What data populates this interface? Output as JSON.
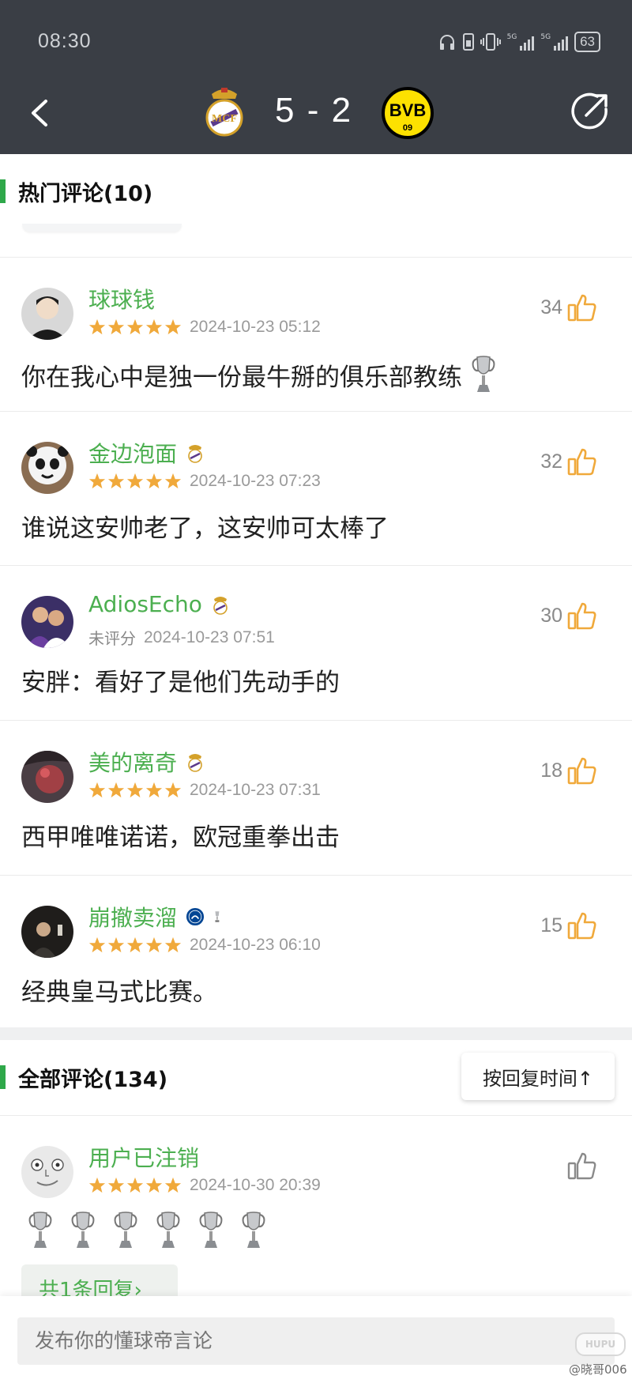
{
  "status_bar": {
    "time": "08:30",
    "battery": "63"
  },
  "match": {
    "score": "5 - 2"
  },
  "hot_section": {
    "title": "热门评论(10)"
  },
  "hot_comments": [
    {
      "user": "球球钱",
      "rated": true,
      "date": "2024-10-23 05:12",
      "text": "你在我心中是独一份最牛掰的俱乐部教练",
      "likes": "34"
    },
    {
      "user": "金边泡面",
      "rated": true,
      "date": "2024-10-23 07:23",
      "text": "谁说这安帅老了，这安帅可太棒了",
      "likes": "32"
    },
    {
      "user": "AdiosEcho",
      "rated": false,
      "unrated_label": "未评分",
      "date": "2024-10-23 07:51",
      "text": "安胖：看好了是他们先动手的",
      "likes": "30"
    },
    {
      "user": "美的离奇",
      "rated": true,
      "date": "2024-10-23 07:31",
      "text": "西甲唯唯诺诺，欧冠重拳出击",
      "likes": "18"
    },
    {
      "user": "崩撤卖溜",
      "rated": true,
      "date": "2024-10-23 06:10",
      "text": "经典皇马式比赛。",
      "likes": "15"
    }
  ],
  "all_section": {
    "title": "全部评论(134)",
    "sort_label": "按回复时间↑"
  },
  "all_comments": [
    {
      "user": "用户已注销",
      "rated": true,
      "date": "2024-10-30 20:39",
      "trophy_count": 6,
      "reply_link": "共1条回复›"
    }
  ],
  "composer": {
    "placeholder": "发布你的懂球帝言论"
  },
  "watermark": {
    "logo": "HUPU",
    "text": "@晓哥006"
  },
  "colors": {
    "header_bg": "#3a3e45",
    "accent_green": "#4caf50",
    "star": "#f0a93b",
    "thumb": "#f0a93b"
  },
  "icons": [
    "back-arrow-icon",
    "real-madrid-crest-icon",
    "bvb-crest-icon",
    "share-icon",
    "star-icon",
    "thumb-up-icon",
    "trophy-icon",
    "chelsea-badge-icon"
  ]
}
